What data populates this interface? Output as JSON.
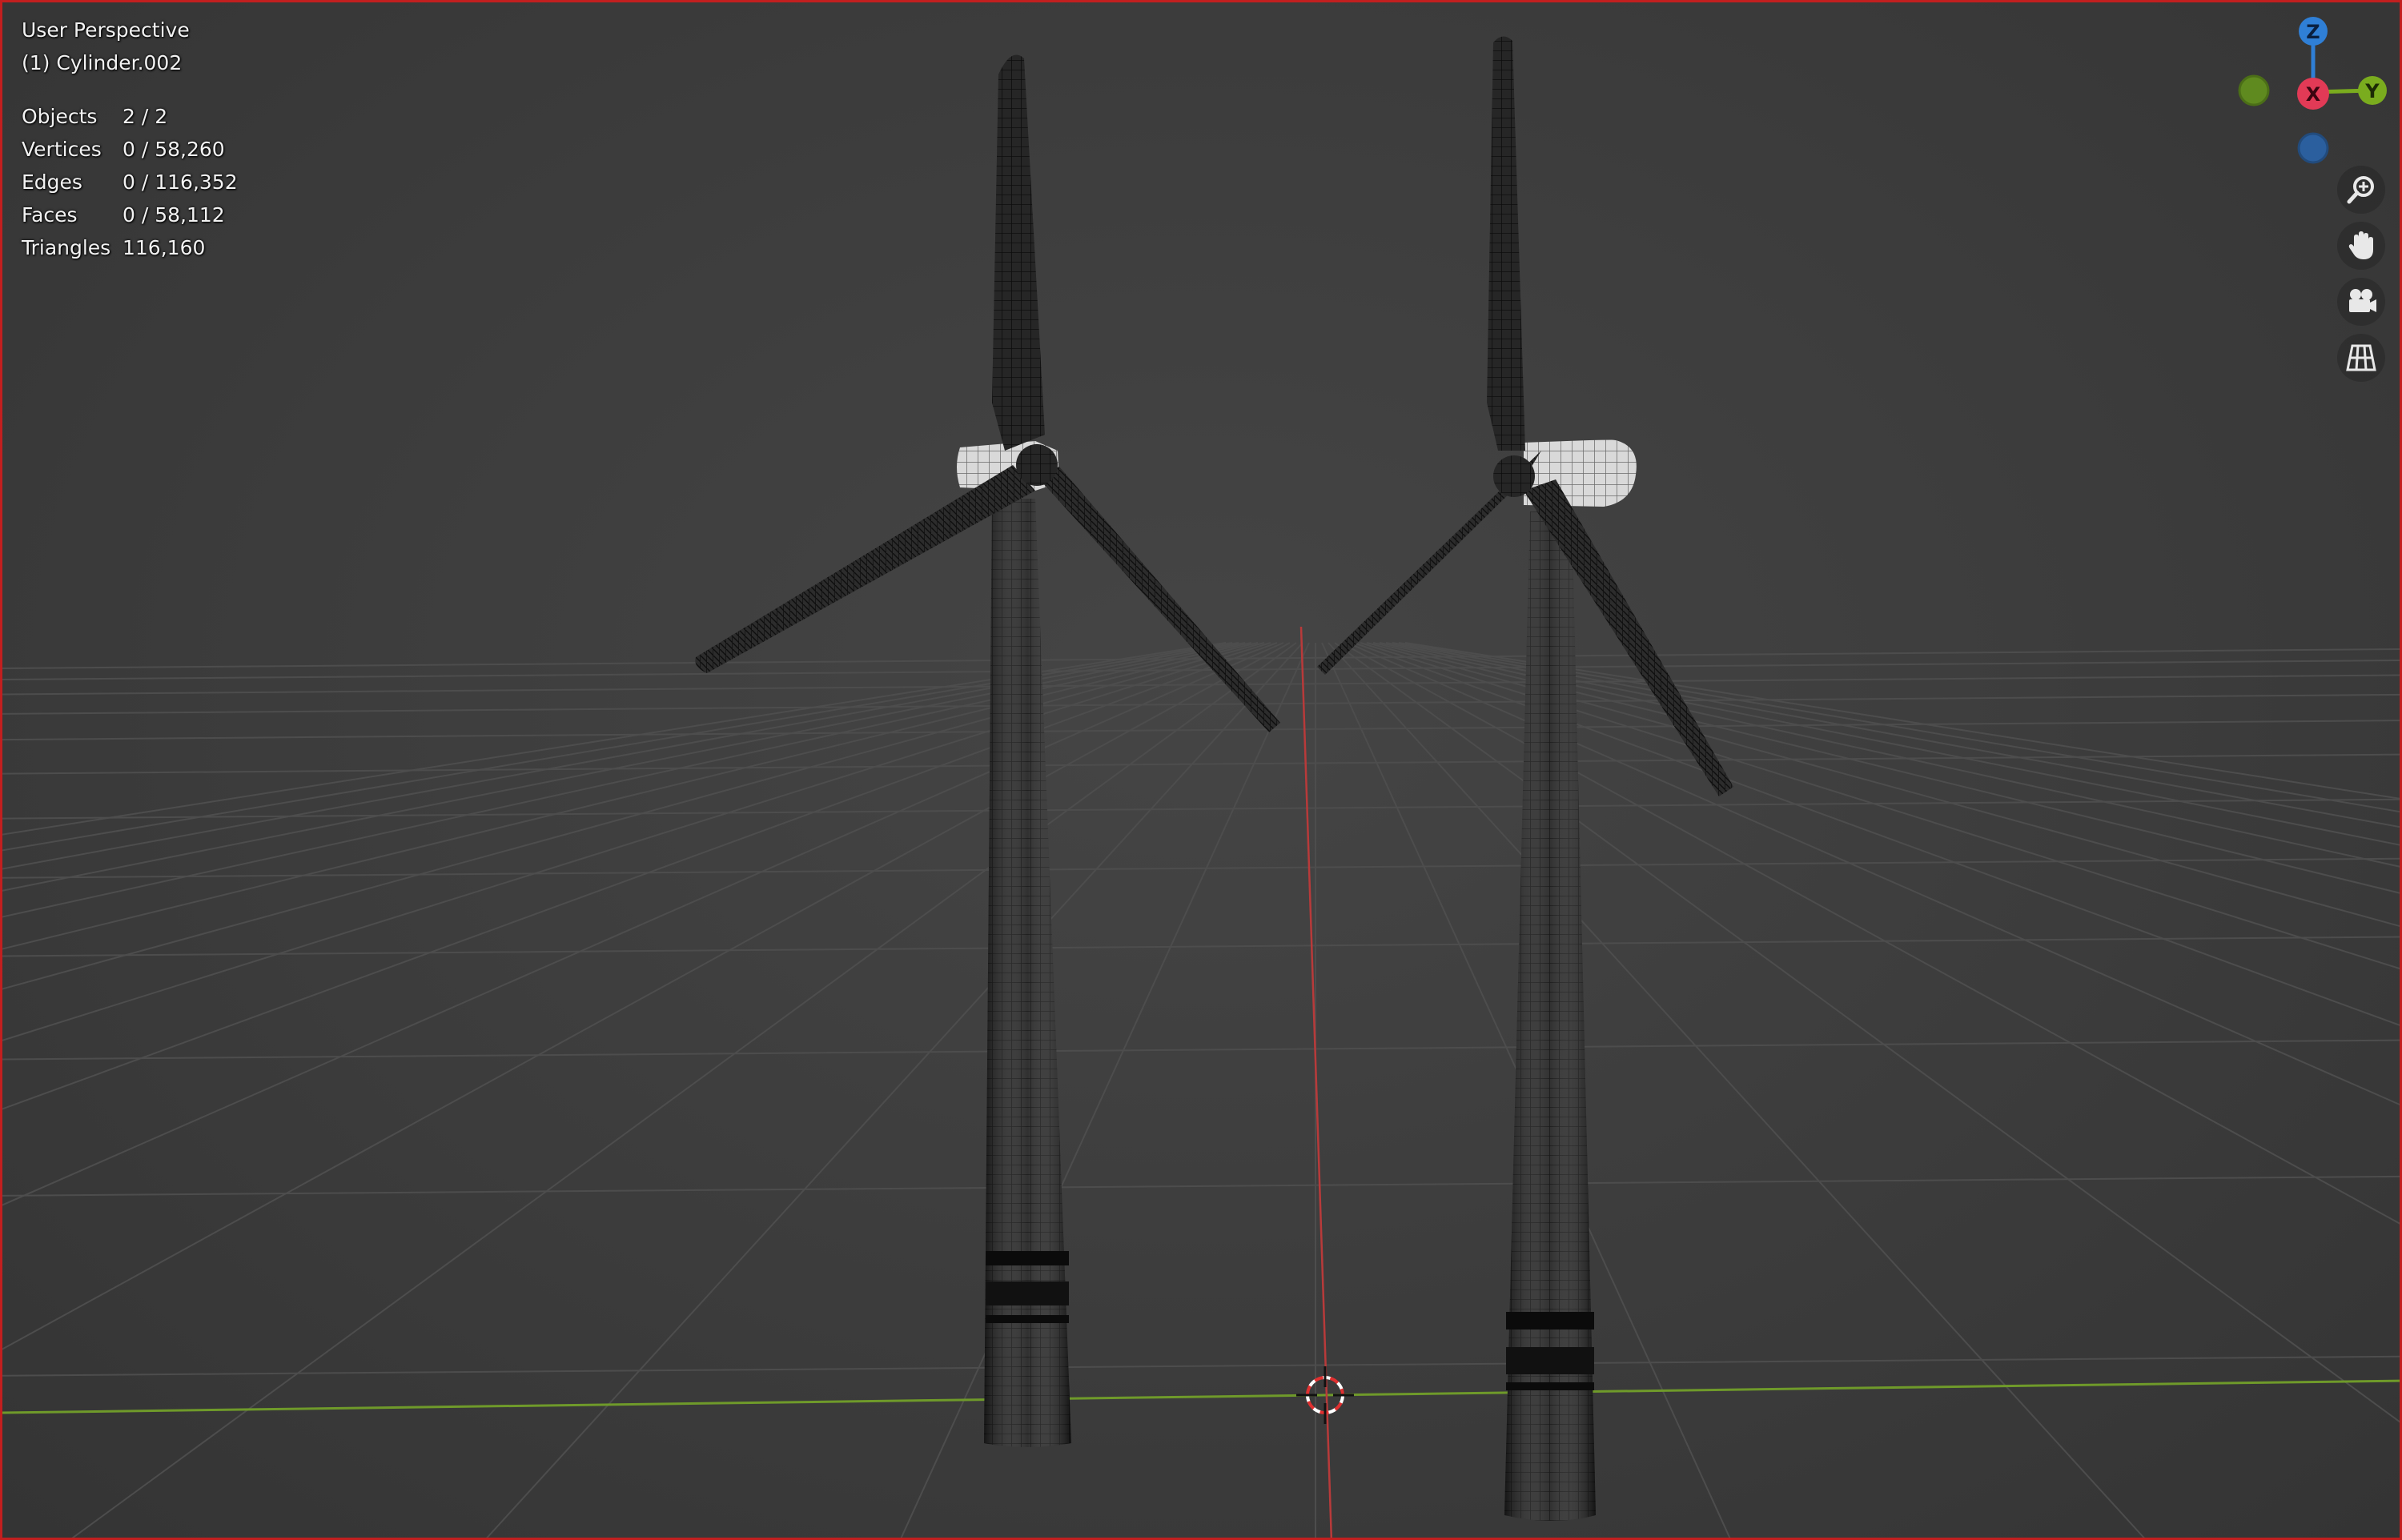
{
  "viewport": {
    "view_name": "User Perspective",
    "active_object": "(1) Cylinder.002",
    "stats": [
      {
        "label": "Objects",
        "value": "2 / 2"
      },
      {
        "label": "Vertices",
        "value": "0 / 58,260"
      },
      {
        "label": "Edges",
        "value": "0 / 116,352"
      },
      {
        "label": "Faces",
        "value": "0 / 58,112"
      },
      {
        "label": "Triangles",
        "value": "116,160"
      }
    ]
  },
  "gizmo": {
    "z_label": "Z",
    "x_label": "X",
    "y_label": "Y",
    "colors": {
      "x": "#e23a56",
      "y": "#7aac1e",
      "z": "#2f7fd6",
      "neg_y": "#5f8a1f",
      "neg_z": "#2b5f9e"
    }
  },
  "nav_tools": [
    {
      "name": "zoom-icon"
    },
    {
      "name": "pan-hand-icon"
    },
    {
      "name": "camera-icon"
    },
    {
      "name": "ortho-grid-icon"
    }
  ],
  "theme": {
    "frame_border": "#c21f1f",
    "x_axis": "#b83a3a",
    "y_axis": "#6f9a2a"
  }
}
